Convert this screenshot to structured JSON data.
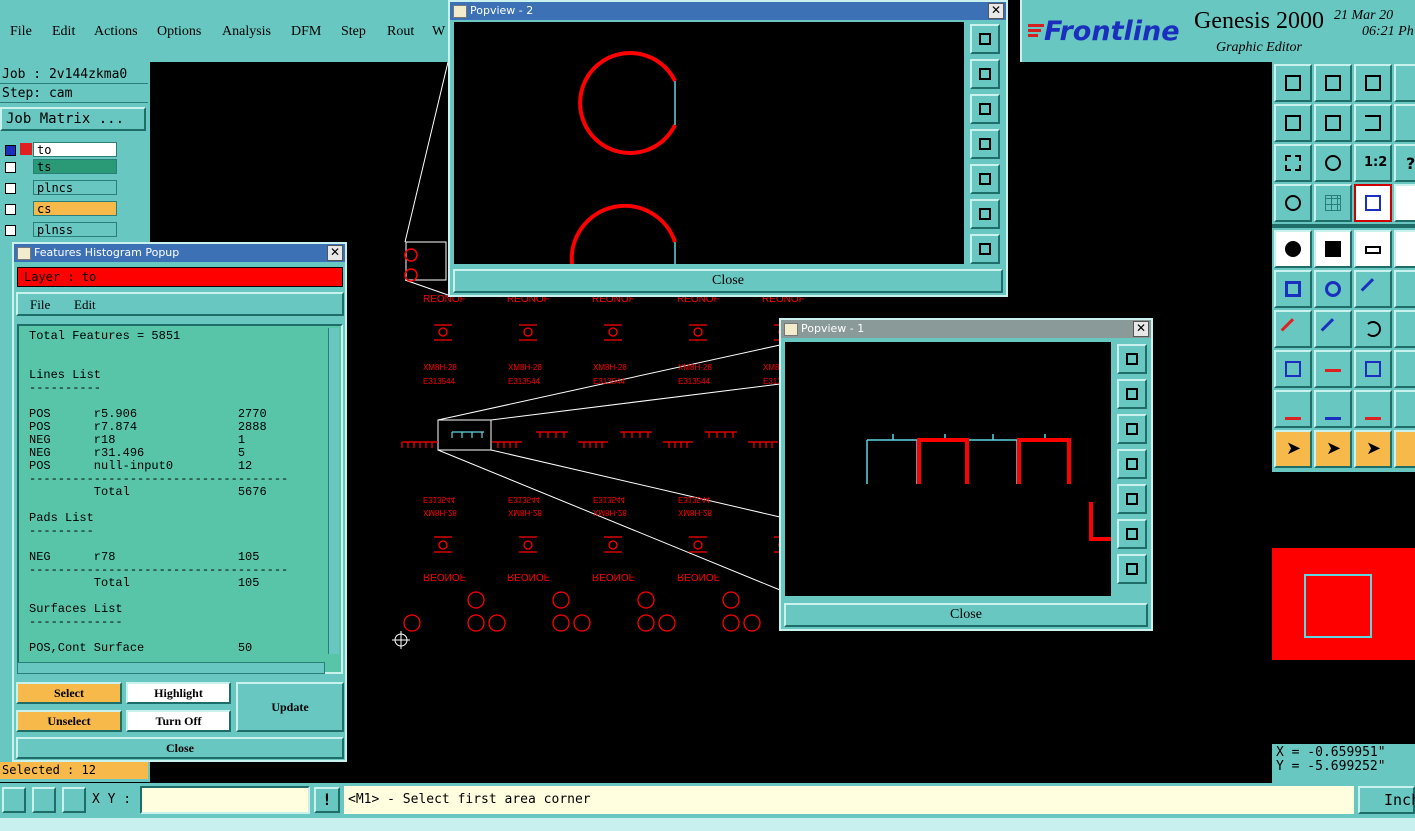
{
  "menu": [
    "File",
    "Edit",
    "Actions",
    "Options",
    "Analysis",
    "DFM",
    "Step",
    "Rout",
    "W"
  ],
  "brand": {
    "logo": "Frontline",
    "product": "Genesis 2000",
    "subtitle": "Graphic Editor",
    "date": "21 Mar 20",
    "time": "06:21 Ph"
  },
  "job": {
    "job_label": "Job : 2v144zkma0",
    "step_label": "Step: cam",
    "matrix_button": "Job Matrix ..."
  },
  "layers": [
    {
      "name": "to",
      "color": "#ffffff"
    },
    {
      "name": "ts",
      "color": "#2a9a76"
    },
    {
      "name": "plncs",
      "color": "#68c7c0"
    },
    {
      "name": "cs",
      "color": "#f6b94a"
    },
    {
      "name": "plnss",
      "color": "#68c7c0"
    }
  ],
  "popview2": {
    "title": "Popview - 2",
    "close": "Close"
  },
  "popview1": {
    "title": "Popview - 1",
    "close": "Close"
  },
  "histogram": {
    "title": "Features Histogram Popup",
    "layer_label": "Layer :  to",
    "menu_file": "File",
    "menu_edit": "Edit",
    "lines": [
      "Total Features = 5851",
      "",
      "Lines List",
      "----------",
      "POS      r5.906              2770",
      "POS      r7.874              2888",
      "NEG      r18                 1",
      "NEG      r31.496             5",
      "POS      null-input0         12",
      "------------------------------------",
      "         Total               5676",
      "",
      "Pads List",
      "---------",
      "NEG      r78                 105",
      "------------------------------------",
      "         Total               105",
      "",
      "Surfaces List",
      "-------------",
      "POS,Cont Surface             50"
    ],
    "btn_select": "Select",
    "btn_highlight": "Highlight",
    "btn_update": "Update",
    "btn_unselect": "Unselect",
    "btn_turnoff": "Turn Off",
    "btn_close": "Close"
  },
  "status": {
    "selected": "Selected : 12",
    "xy_label": "X Y :",
    "xy_value": "",
    "prompt": "<M1> - Select first area corner",
    "units": "Inch"
  },
  "coords": {
    "x": "X = -0.659951\"",
    "y": "Y = -5.699252\""
  },
  "board_labels": {
    "reonof": "REONOF",
    "part_top": "XM8H-28",
    "part_code": "E313544"
  },
  "colors": {
    "teal": "#68c7c0",
    "red": "#ff0000",
    "cyan": "#5fd6e0",
    "orange": "#f6b94a"
  }
}
